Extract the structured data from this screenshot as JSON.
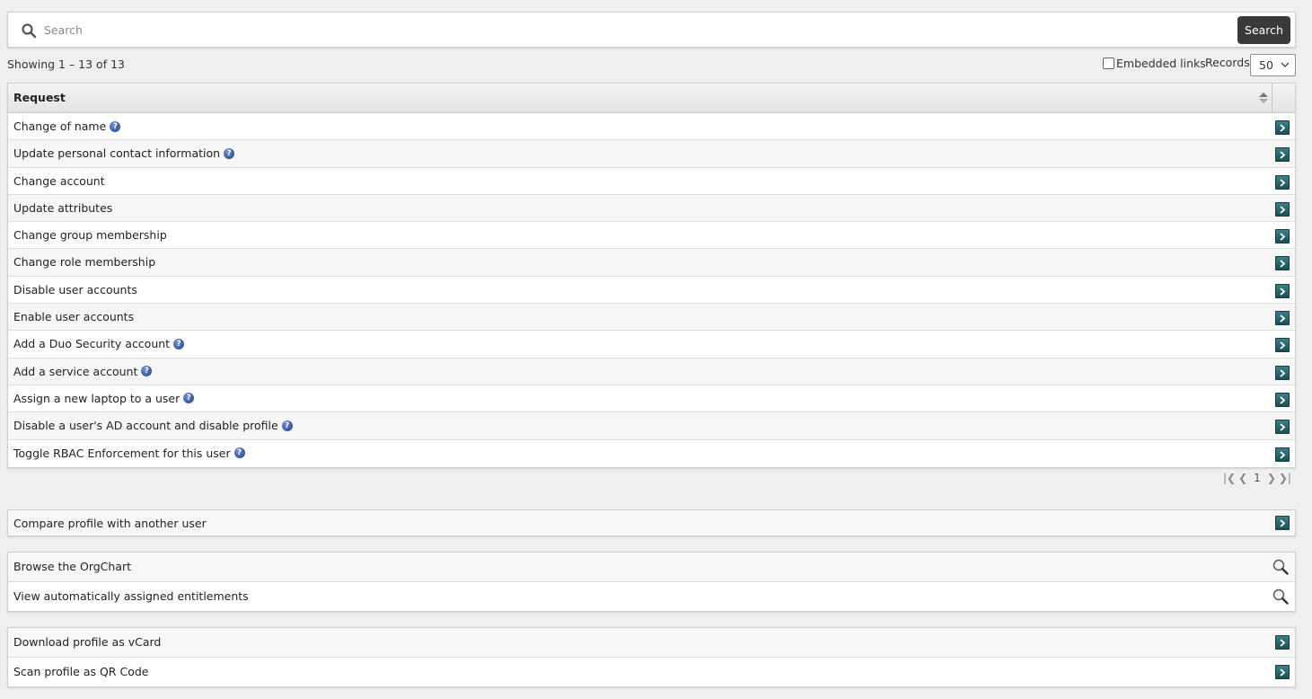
{
  "search": {
    "placeholder": "Search",
    "button_label": "Search"
  },
  "info": {
    "showing": "Showing 1 – 13 of 13",
    "embedded_links_label": "Embedded links",
    "embedded_links_checked": false,
    "records_label": "Records",
    "records_value": "50"
  },
  "table": {
    "header": "Request",
    "rows": [
      {
        "label": "Change of name",
        "help": true
      },
      {
        "label": "Update personal contact information",
        "help": true
      },
      {
        "label": "Change account",
        "help": false
      },
      {
        "label": "Update attributes",
        "help": false
      },
      {
        "label": "Change group membership",
        "help": false
      },
      {
        "label": "Change role membership",
        "help": false
      },
      {
        "label": "Disable user accounts",
        "help": false
      },
      {
        "label": "Enable user accounts",
        "help": false
      },
      {
        "label": "Add a Duo Security account",
        "help": true
      },
      {
        "label": "Add a service account",
        "help": true
      },
      {
        "label": "Assign a new laptop to a user",
        "help": true
      },
      {
        "label": "Disable a user's AD account and disable profile",
        "help": true
      },
      {
        "label": "Toggle RBAC Enforcement for this user",
        "help": true
      }
    ]
  },
  "pager": {
    "current_page": "1"
  },
  "panels": {
    "compare": "Compare profile with another user",
    "browse_orgchart": "Browse the OrgChart",
    "view_entitlements": "View automatically assigned entitlements",
    "download_vcard": "Download profile as vCard",
    "scan_qr": "Scan profile as QR Code"
  },
  "colors": {
    "search_button": "#3a3a3a",
    "go_icon": "#2a6670",
    "help_icon": "#2b4f9e"
  }
}
